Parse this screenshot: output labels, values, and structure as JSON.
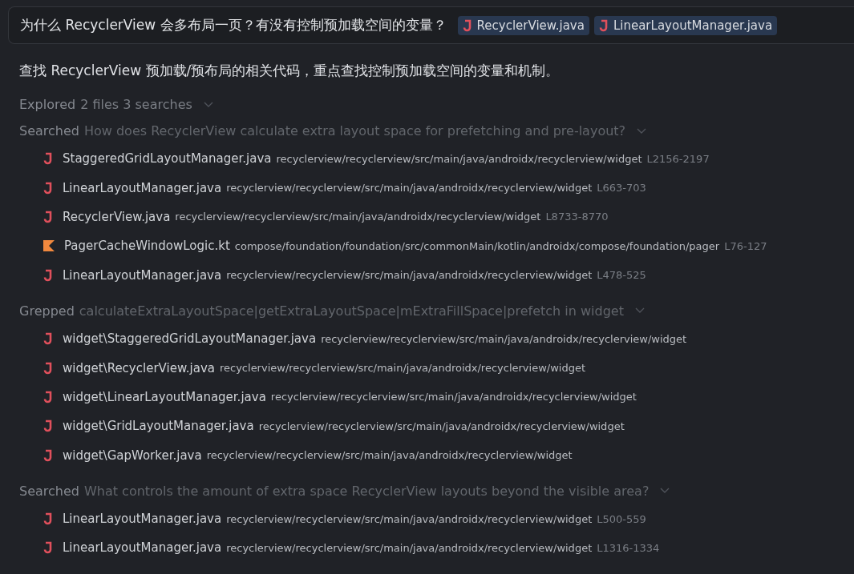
{
  "prompt": {
    "text": "为什么 RecyclerView 会多布局一页？有没有控制预加载空间的变量？",
    "attachments": [
      {
        "name": "RecyclerView.java",
        "kind": "java"
      },
      {
        "name": "LinearLayoutManager.java",
        "kind": "java"
      }
    ]
  },
  "response": {
    "text": "查找 RecyclerView 预加载/预布局的相关代码，重点查找控制预加载空间的变量和机制。"
  },
  "explored": {
    "label": "Explored",
    "summary": "2 files 3 searches"
  },
  "steps": [
    {
      "label": "Searched",
      "query": "How does RecyclerView calculate extra layout space for prefetching and pre-layout?",
      "results": [
        {
          "kind": "java",
          "file": "StaggeredGridLayoutManager.java",
          "path": "recyclerview/recyclerview/src/main/java/androidx/recyclerview/widget",
          "lines": "L2156-2197"
        },
        {
          "kind": "java",
          "file": "LinearLayoutManager.java",
          "path": "recyclerview/recyclerview/src/main/java/androidx/recyclerview/widget",
          "lines": "L663-703"
        },
        {
          "kind": "java",
          "file": "RecyclerView.java",
          "path": "recyclerview/recyclerview/src/main/java/androidx/recyclerview/widget",
          "lines": "L8733-8770"
        },
        {
          "kind": "kotlin",
          "file": "PagerCacheWindowLogic.kt",
          "path": "compose/foundation/foundation/src/commonMain/kotlin/androidx/compose/foundation/pager",
          "lines": "L76-127"
        },
        {
          "kind": "java",
          "file": "LinearLayoutManager.java",
          "path": "recyclerview/recyclerview/src/main/java/androidx/recyclerview/widget",
          "lines": "L478-525"
        }
      ]
    },
    {
      "label": "Grepped",
      "query": "calculateExtraLayoutSpace|getExtraLayoutSpace|mExtraFillSpace|prefetch in widget",
      "results": [
        {
          "kind": "java",
          "file": "widget\\StaggeredGridLayoutManager.java",
          "path": "recyclerview/recyclerview/src/main/java/androidx/recyclerview/widget"
        },
        {
          "kind": "java",
          "file": "widget\\RecyclerView.java",
          "path": "recyclerview/recyclerview/src/main/java/androidx/recyclerview/widget"
        },
        {
          "kind": "java",
          "file": "widget\\LinearLayoutManager.java",
          "path": "recyclerview/recyclerview/src/main/java/androidx/recyclerview/widget"
        },
        {
          "kind": "java",
          "file": "widget\\GridLayoutManager.java",
          "path": "recyclerview/recyclerview/src/main/java/androidx/recyclerview/widget"
        },
        {
          "kind": "java",
          "file": "widget\\GapWorker.java",
          "path": "recyclerview/recyclerview/src/main/java/androidx/recyclerview/widget"
        }
      ]
    },
    {
      "label": "Searched",
      "query": "What controls the amount of extra space RecyclerView layouts beyond the visible area?",
      "results": [
        {
          "kind": "java",
          "file": "LinearLayoutManager.java",
          "path": "recyclerview/recyclerview/src/main/java/androidx/recyclerview/widget",
          "lines": "L500-559"
        },
        {
          "kind": "java",
          "file": "LinearLayoutManager.java",
          "path": "recyclerview/recyclerview/src/main/java/androidx/recyclerview/widget",
          "lines": "L1316-1334"
        }
      ]
    }
  ]
}
